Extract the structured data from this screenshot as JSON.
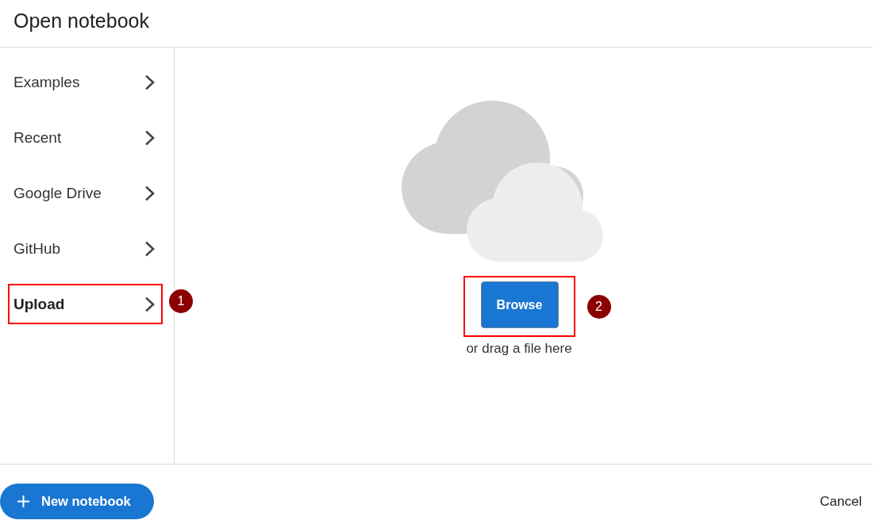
{
  "dialog": {
    "title": "Open notebook"
  },
  "sidebar": {
    "items": [
      {
        "label": "Examples",
        "selected": false
      },
      {
        "label": "Recent",
        "selected": false
      },
      {
        "label": "Google Drive",
        "selected": false
      },
      {
        "label": "GitHub",
        "selected": false
      },
      {
        "label": "Upload",
        "selected": true,
        "callout": "1"
      }
    ]
  },
  "upload": {
    "browse_button": {
      "label": "Browse",
      "callout": "2"
    },
    "hint": "or drag a file here"
  },
  "footer": {
    "new_button": {
      "label": "New notebook"
    },
    "cancel_button": {
      "label": "Cancel"
    }
  }
}
